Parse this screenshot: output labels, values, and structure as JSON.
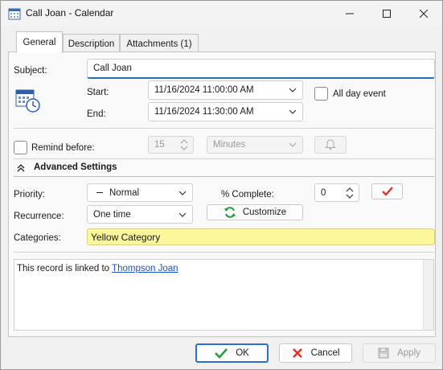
{
  "window": {
    "title": "Call Joan - Calendar"
  },
  "tabs": [
    {
      "label": "General",
      "active": true
    },
    {
      "label": "Description",
      "active": false
    },
    {
      "label": "Attachments (1)",
      "active": false
    }
  ],
  "form": {
    "subject_label": "Subject:",
    "subject_value": "Call Joan",
    "start_label": "Start:",
    "start_value": "11/16/2024 11:00:00 AM",
    "end_label": "End:",
    "end_value": "11/16/2024 11:30:00 AM",
    "all_day_label": "All day event",
    "remind_label": "Remind before:",
    "remind_value": "15",
    "remind_unit": "Minutes",
    "advanced_label": "Advanced Settings",
    "priority_label": "Priority:",
    "priority_value": "Normal",
    "complete_label": "% Complete:",
    "complete_value": "0",
    "recurrence_label": "Recurrence:",
    "recurrence_value": "One time",
    "customize_label": "Customize",
    "categories_label": "Categories:",
    "categories_value": "Yellow Category",
    "memo_text": "This record is linked to ",
    "memo_link": "Thompson Joan"
  },
  "footer": {
    "ok_label": "OK",
    "cancel_label": "Cancel",
    "apply_label": "Apply"
  },
  "colors": {
    "accent": "#2a6fd0",
    "category": "#fbf79a",
    "link": "#1f4fbf",
    "cancel_x": "#d9352b",
    "ok_check": "#2a9a3c"
  }
}
